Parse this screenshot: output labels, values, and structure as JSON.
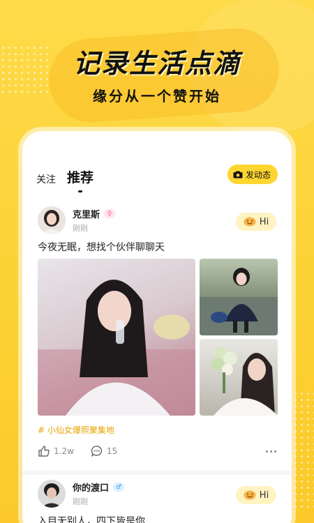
{
  "promo": {
    "headline": "记录生活点滴",
    "subline": "缘分从一个赞开始"
  },
  "tabs": [
    {
      "label": "关注",
      "active": false
    },
    {
      "label": "推荐",
      "active": true
    }
  ],
  "post_button": {
    "label": "发动态",
    "icon": "camera-icon"
  },
  "posts": [
    {
      "user": "克里斯",
      "gender": "female",
      "gender_symbol": "♀",
      "time": "刚刚",
      "hi_label": "Hi",
      "text": "今夜无眠，想找个伙伴聊聊天",
      "photo_count": 3,
      "topic": "# 小仙女爆照聚集地",
      "likes": "1.2w",
      "comments": "15"
    },
    {
      "user": "你的渡口",
      "gender": "male",
      "gender_symbol": "♂",
      "time": "刚刚",
      "hi_label": "Hi",
      "text": "入目无别人，四下皆是你"
    }
  ],
  "colors": {
    "accent": "#fed531",
    "background": "#fdd23a",
    "topic": "#e8a400"
  }
}
